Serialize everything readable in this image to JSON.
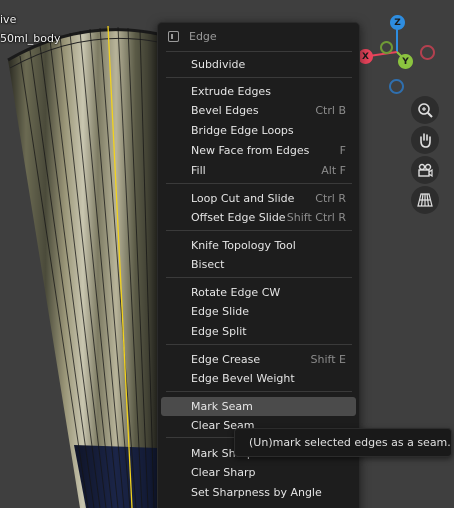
{
  "viewport": {
    "mode_text_partial": "ive",
    "object_name_partial": "50ml_body"
  },
  "gizmo": {
    "z_label": "Z",
    "x_label": "X",
    "y_label": "Y",
    "colors": {
      "x": "#e8445b",
      "y": "#8bc43f",
      "z": "#2e8de0"
    }
  },
  "nav_buttons": [
    "zoom-icon",
    "hand-pan-icon",
    "camera-icon",
    "grid-ortho-icon"
  ],
  "menu": {
    "title": "Edge",
    "items": [
      {
        "label": "Subdivide",
        "shortcut": ""
      },
      {
        "label": "Extrude Edges",
        "shortcut": ""
      },
      {
        "label": "Bevel Edges",
        "shortcut": "Ctrl B"
      },
      {
        "label": "Bridge Edge Loops",
        "shortcut": ""
      },
      {
        "label": "New Face from Edges",
        "shortcut": "F"
      },
      {
        "label": "Fill",
        "shortcut": "Alt F"
      },
      {
        "label": "Loop Cut and Slide",
        "shortcut": "Ctrl R"
      },
      {
        "label": "Offset Edge Slide",
        "shortcut": "Shift Ctrl R"
      },
      {
        "label": "Knife Topology Tool",
        "shortcut": ""
      },
      {
        "label": "Bisect",
        "shortcut": ""
      },
      {
        "label": "Rotate Edge CW",
        "shortcut": ""
      },
      {
        "label": "Edge Slide",
        "shortcut": ""
      },
      {
        "label": "Edge Split",
        "shortcut": ""
      },
      {
        "label": "Edge Crease",
        "shortcut": "Shift E"
      },
      {
        "label": "Edge Bevel Weight",
        "shortcut": ""
      },
      {
        "label": "Mark Seam",
        "shortcut": ""
      },
      {
        "label": "Clear Seam",
        "shortcut": ""
      },
      {
        "label": "Mark Sharp",
        "shortcut": ""
      },
      {
        "label": "Clear Sharp",
        "shortcut": ""
      },
      {
        "label": "Set Sharpness by Angle",
        "shortcut": ""
      }
    ],
    "highlighted": "Mark Seam"
  },
  "tooltip": {
    "text": "(Un)mark selected edges as a seam."
  }
}
